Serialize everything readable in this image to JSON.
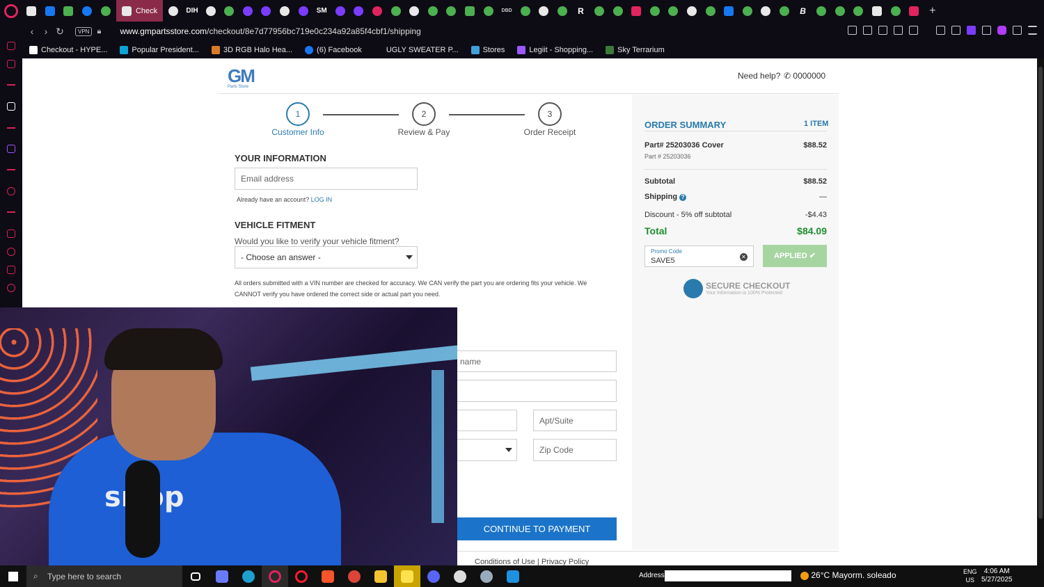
{
  "browser": {
    "active_tab": "Check",
    "url_domain": "www.gmpartsstore.com",
    "url_path": "/checkout/8e7d77956bc719e0c234a92a85f4cbf1/shipping",
    "vpn_label": "VPN",
    "tab_texts": [
      "DIH",
      "SM",
      "DBD",
      "R",
      "B"
    ],
    "bookmarks": [
      "Checkout - HYPE...",
      "Popular President...",
      "3D RGB Halo Hea...",
      "(6) Facebook",
      "UGLY SWEATER P...",
      "Stores",
      "Legiit - Shopping...",
      "Sky Terrarium"
    ]
  },
  "header": {
    "logo_text": "GM",
    "logo_sub": "Parts Store",
    "need_help": "Need help?",
    "phone": "0000000"
  },
  "steps": [
    {
      "num": "1",
      "label": "Customer Info"
    },
    {
      "num": "2",
      "label": "Review & Pay"
    },
    {
      "num": "3",
      "label": "Order Receipt"
    }
  ],
  "your_info": {
    "title": "YOUR INFORMATION",
    "email_placeholder": "Email address",
    "account_text": "Already have an account?",
    "login_link": "LOG IN"
  },
  "vehicle": {
    "title": "VEHICLE FITMENT",
    "question": "Would you like to verify your vehicle fitment?",
    "select_value": "- Choose an answer -",
    "note": "All orders submitted with a VIN number are checked for accuracy. We CAN verify the part you are ordering fits your vehicle. We CANNOT verify you have ordered the correct side or actual part you need."
  },
  "shipping_fields": {
    "name_partial": "name",
    "apt": "Apt/Suite",
    "zip": "Zip Code"
  },
  "continue_label": "CONTINUE TO PAYMENT",
  "footer": {
    "conditions": "Conditions of Use",
    "sep": "|",
    "privacy": "Privacy Policy"
  },
  "summary": {
    "title": "ORDER SUMMARY",
    "count": "1 ITEM",
    "item_name": "Part# 25203036 Cover",
    "item_price": "$88.52",
    "item_part": "Part # 25203036",
    "subtotal_label": "Subtotal",
    "subtotal": "$88.52",
    "shipping_label": "Shipping",
    "shipping": "—",
    "discount_label": "Discount - 5% off subtotal",
    "discount": "-$4.43",
    "total_label": "Total",
    "total": "$84.09",
    "promo_label": "Promo Code",
    "promo_value": "SAVE5",
    "applied": "APPLIED ✔",
    "secure_title": "SECURE CHECKOUT",
    "secure_sub": "Your Information is 100% Protected"
  },
  "webcam": {
    "shirt_text": "sribp"
  },
  "taskbar": {
    "search_placeholder": "Type here to search",
    "address_label": "Address",
    "weather": "26°C  Mayorm. soleado",
    "lang": "ENG",
    "region": "US",
    "time": "4:06 AM",
    "date": "5/27/2025"
  }
}
